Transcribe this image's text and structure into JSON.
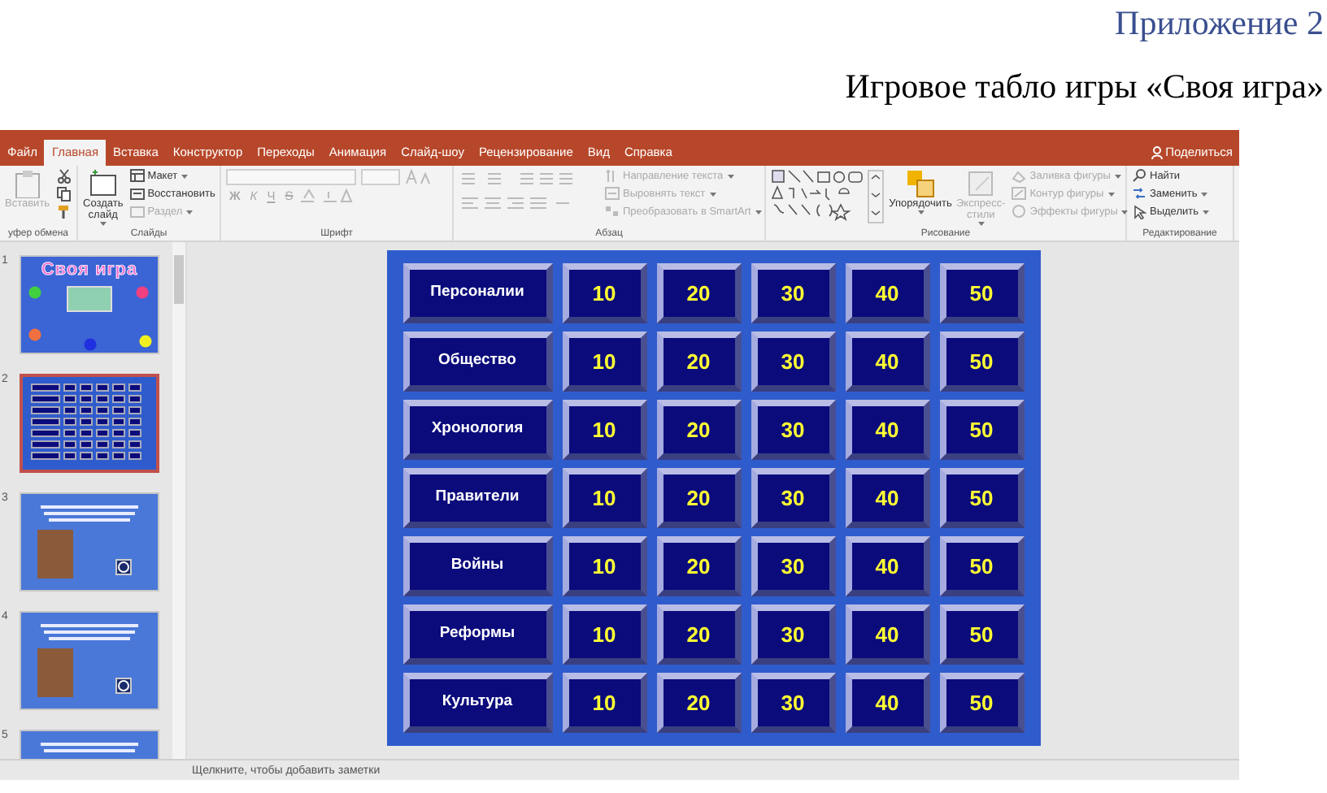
{
  "document": {
    "appendix": "Приложение 2",
    "title": "Игровое табло игры «Своя игра»"
  },
  "tabs": [
    {
      "label": "Файл",
      "selected": false
    },
    {
      "label": "Главная",
      "selected": true
    },
    {
      "label": "Вставка",
      "selected": false
    },
    {
      "label": "Конструктор",
      "selected": false
    },
    {
      "label": "Переходы",
      "selected": false
    },
    {
      "label": "Анимация",
      "selected": false
    },
    {
      "label": "Слайд-шоу",
      "selected": false
    },
    {
      "label": "Рецензирование",
      "selected": false
    },
    {
      "label": "Вид",
      "selected": false
    },
    {
      "label": "Справка",
      "selected": false
    }
  ],
  "share": "Поделиться",
  "ribbon_groups": [
    {
      "kind": "clipboard",
      "label": "уфер обмена",
      "items": [
        {
          "kind": "large",
          "label": "Вставить",
          "disabled": true,
          "dropdown": false
        }
      ]
    },
    {
      "kind": "slides",
      "label": "Слайды",
      "items": [
        {
          "kind": "large",
          "label": "Создать слайд",
          "disabled": false,
          "dropdown": true
        },
        {
          "kind": "small",
          "label": "Макет",
          "disabled": false,
          "dropdown": true
        },
        {
          "kind": "small",
          "label": "Восстановить",
          "disabled": false,
          "dropdown": false
        },
        {
          "kind": "small",
          "label": "Раздел",
          "disabled": true,
          "dropdown": true
        }
      ]
    },
    {
      "kind": "font",
      "label": "Шрифт",
      "font_buttons": [
        {
          "label": "Ж",
          "kind": "bold"
        },
        {
          "label": "К",
          "kind": "italic"
        },
        {
          "label": "Ч",
          "kind": "underline"
        },
        {
          "label": "S",
          "kind": "strike"
        }
      ]
    },
    {
      "kind": "paragraph",
      "label": "Абзац",
      "items": [
        {
          "kind": "small",
          "label": "Направление текста",
          "disabled": true,
          "dropdown": true
        },
        {
          "kind": "small",
          "label": "Выровнять текст",
          "disabled": true,
          "dropdown": true
        },
        {
          "kind": "small",
          "label": "Преобразовать в SmartArt",
          "disabled": true,
          "dropdown": true
        }
      ]
    },
    {
      "kind": "drawing",
      "label": "Рисование",
      "items": [
        {
          "kind": "large",
          "label": "Упорядочить",
          "disabled": false,
          "dropdown": true
        },
        {
          "kind": "large",
          "label": "Экспресс-стили",
          "disabled": true,
          "dropdown": true
        },
        {
          "kind": "small",
          "label": "Заливка фигуры",
          "disabled": true,
          "dropdown": true
        },
        {
          "kind": "small",
          "label": "Контур фигуры",
          "disabled": true,
          "dropdown": true
        },
        {
          "kind": "small",
          "label": "Эффекты фигуры",
          "disabled": true,
          "dropdown": true
        }
      ]
    },
    {
      "kind": "editing",
      "label": "Редактирование",
      "items": [
        {
          "kind": "small",
          "label": "Найти",
          "disabled": false,
          "dropdown": false
        },
        {
          "kind": "small",
          "label": "Заменить",
          "disabled": false,
          "dropdown": true
        },
        {
          "kind": "small",
          "label": "Выделить",
          "disabled": false,
          "dropdown": true
        }
      ]
    }
  ],
  "thumbnails": [
    {
      "number": "1",
      "kind": "title",
      "title": "Своя игра",
      "selected": false
    },
    {
      "number": "2",
      "kind": "board",
      "selected": true
    },
    {
      "number": "3",
      "kind": "portrait",
      "selected": false
    },
    {
      "number": "4",
      "kind": "portrait",
      "selected": false
    },
    {
      "number": "5",
      "kind": "text",
      "selected": false
    }
  ],
  "slide": {
    "rows": [
      {
        "category": "Персоналии",
        "points": [
          "10",
          "20",
          "30",
          "40",
          "50"
        ]
      },
      {
        "category": "Общество",
        "points": [
          "10",
          "20",
          "30",
          "40",
          "50"
        ]
      },
      {
        "category": "Хронология",
        "points": [
          "10",
          "20",
          "30",
          "40",
          "50"
        ]
      },
      {
        "category": "Правители",
        "points": [
          "10",
          "20",
          "30",
          "40",
          "50"
        ]
      },
      {
        "category": "Войны",
        "points": [
          "10",
          "20",
          "30",
          "40",
          "50"
        ]
      },
      {
        "category": "Реформы",
        "points": [
          "10",
          "20",
          "30",
          "40",
          "50"
        ]
      },
      {
        "category": "Культура",
        "points": [
          "10",
          "20",
          "30",
          "40",
          "50"
        ]
      }
    ]
  },
  "notes": {
    "placeholder": "Щелкните, чтобы добавить заметки"
  }
}
